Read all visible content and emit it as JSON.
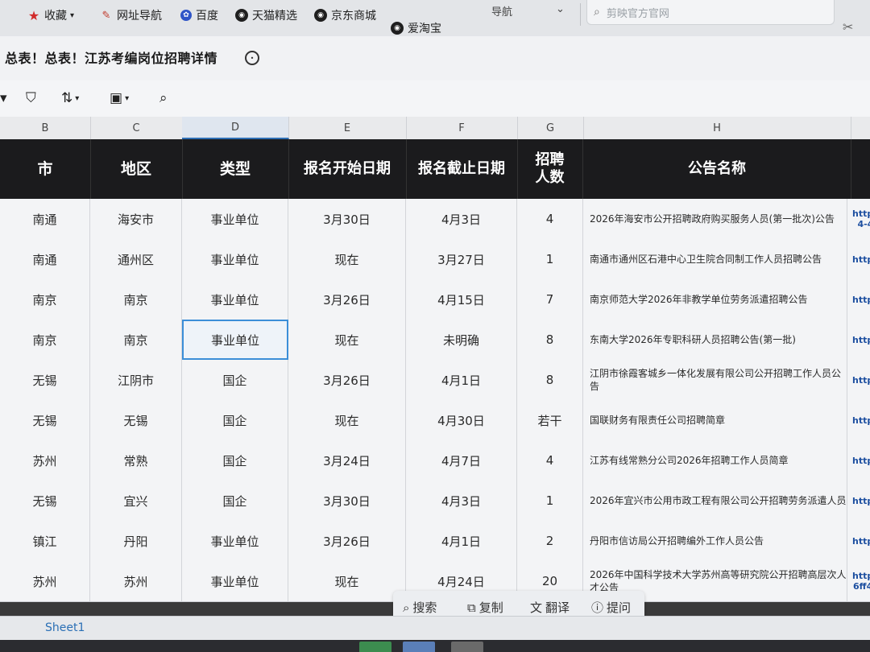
{
  "bookmarks": {
    "items": [
      {
        "label": "收藏",
        "icon": "star-icon"
      },
      {
        "label": "网址导航",
        "icon": "navigation-icon"
      },
      {
        "label": "百度",
        "icon": "baidu-paw-icon"
      },
      {
        "label": "天猫精选",
        "icon": "globe-icon"
      },
      {
        "label": "京东商城",
        "icon": "globe-icon"
      },
      {
        "label": "爱淘宝",
        "icon": "globe-icon"
      }
    ],
    "search_placeholder": "剪映官方官网",
    "nav_label": "导航"
  },
  "document": {
    "title": "总表！总表！江苏考编岗位招聘详情"
  },
  "columns": {
    "letters": [
      "B",
      "C",
      "D",
      "E",
      "F",
      "G",
      "H"
    ],
    "active": "D"
  },
  "headers": [
    "市",
    "地区",
    "类型",
    "报名开始日期",
    "报名截止日期",
    "招聘人数",
    "公告名称"
  ],
  "rows": [
    {
      "city": "南通",
      "area": "海安市",
      "type": "事业单位",
      "start": "3月30日",
      "end": "4月3日",
      "count": "4",
      "notice": "2026年海安市公开招聘政府购买服务人员(第一批次)公告",
      "link": "https:// 4-4f5"
    },
    {
      "city": "南通",
      "area": "通州区",
      "type": "事业单位",
      "start": "现在",
      "end": "3月27日",
      "count": "1",
      "notice": "南通市通州区石港中心卫生院合同制工作人员招聘公告",
      "link": "https:"
    },
    {
      "city": "南京",
      "area": "南京",
      "type": "事业单位",
      "start": "3月26日",
      "end": "4月15日",
      "count": "7",
      "notice": "南京师范大学2026年非教学单位劳务派遣招聘公告",
      "link": "https:"
    },
    {
      "city": "南京",
      "area": "南京",
      "type": "事业单位",
      "start": "现在",
      "end": "未明确",
      "count": "8",
      "notice": "东南大学2026年专职科研人员招聘公告(第一批)",
      "link": "https:"
    },
    {
      "city": "无锡",
      "area": "江阴市",
      "type": "国企",
      "start": "3月26日",
      "end": "4月1日",
      "count": "8",
      "notice": "江阴市徐霞客城乡一体化发展有限公司公开招聘工作人员公告",
      "link": "https:"
    },
    {
      "city": "无锡",
      "area": "无锡",
      "type": "国企",
      "start": "现在",
      "end": "4月30日",
      "count": "若干",
      "notice": "国联财务有限责任公司招聘简章",
      "link": "http"
    },
    {
      "city": "苏州",
      "area": "常熟",
      "type": "国企",
      "start": "3月24日",
      "end": "4月7日",
      "count": "4",
      "notice": "江苏有线常熟分公司2026年招聘工作人员简章",
      "link": "http"
    },
    {
      "city": "无锡",
      "area": "宜兴",
      "type": "国企",
      "start": "3月30日",
      "end": "4月3日",
      "count": "1",
      "notice": "2026年宜兴市公用市政工程有限公司公开招聘劳务派遣人员",
      "link": "http"
    },
    {
      "city": "镇江",
      "area": "丹阳",
      "type": "事业单位",
      "start": "3月26日",
      "end": "4月1日",
      "count": "2",
      "notice": "丹阳市信访局公开招聘编外工作人员公告",
      "link": "http"
    },
    {
      "city": "苏州",
      "area": "苏州",
      "type": "事业单位",
      "start": "现在",
      "end": "4月24日",
      "count": "20",
      "notice": "2026年中国科学技术大学苏州高等研究院公开招聘高层次人才公告",
      "link": "http 6ff4"
    }
  ],
  "selected_cell": {
    "row": 4,
    "column": "D"
  },
  "context_toolbar": [
    {
      "label": "搜索",
      "icon": "search-icon"
    },
    {
      "label": "复制",
      "icon": "copy-icon"
    },
    {
      "label": "翻译",
      "icon": "translate-icon"
    },
    {
      "label": "提问",
      "icon": "question-icon"
    }
  ],
  "sheet": {
    "tab": "Sheet1"
  }
}
